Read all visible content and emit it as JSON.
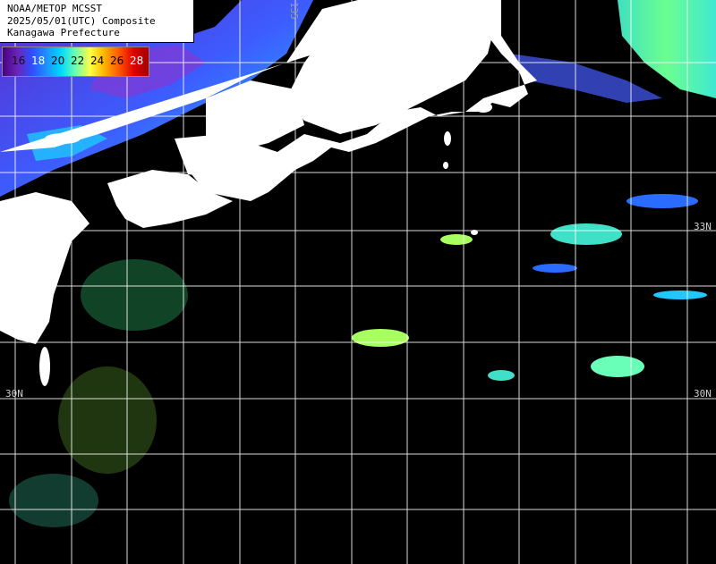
{
  "title": {
    "line1": "NOAA/METOP MCSST",
    "line2": "2025/05/01(UTC) Composite",
    "line3": "Kanagawa Prefecture"
  },
  "legend": {
    "labels": [
      "16",
      "18",
      "20",
      "22",
      "24",
      "26",
      "28"
    ],
    "label_colors": [
      "#1a1a6e",
      "#ffffff",
      "#000000",
      "#000000",
      "#000000",
      "#000000",
      "#ffffff"
    ]
  },
  "lat_labels": {
    "right_33": "33N",
    "left_30": "30N",
    "right_30": "30N",
    "top_edge": "135"
  },
  "colors": {
    "land": "#ffffff",
    "cloud_mask": "#000000",
    "grid": "#ffffff"
  }
}
